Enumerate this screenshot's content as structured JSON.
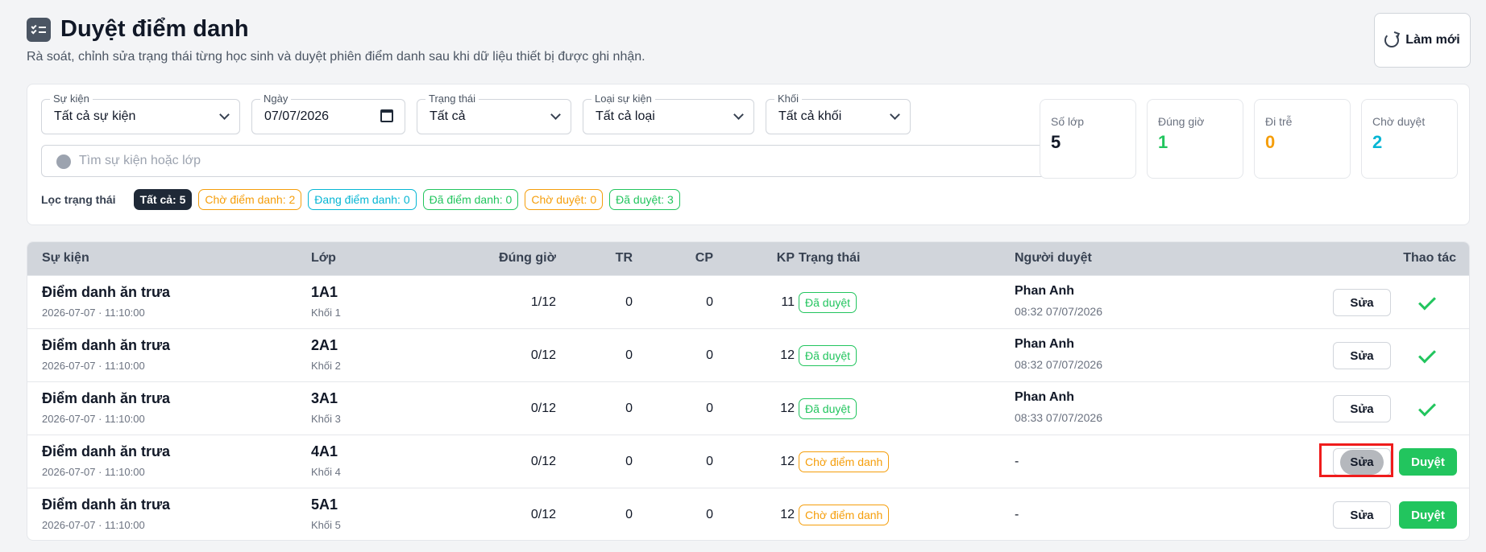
{
  "header": {
    "title": "Duyệt điểm danh",
    "subtitle": "Rà soát, chỉnh sửa trạng thái từng học sinh và duyệt phiên điểm danh sau khi dữ liệu thiết bị được ghi nhận.",
    "refresh_label": "Làm mới"
  },
  "filters": {
    "event": {
      "label": "Sự kiện",
      "value": "Tất cả sự kiện"
    },
    "date": {
      "label": "Ngày",
      "value": "07/07/2026"
    },
    "status": {
      "label": "Trạng thái",
      "value": "Tất cả"
    },
    "event_type": {
      "label": "Loại sự kiện",
      "value": "Tất cả loại"
    },
    "grade": {
      "label": "Khối",
      "value": "Tất cả khối"
    },
    "search_placeholder": "Tìm sự kiện hoặc lớp"
  },
  "status_filter": {
    "label": "Lọc trạng thái",
    "chips": [
      "Tất cả: 5",
      "Chờ điểm danh: 2",
      "Đang điểm danh: 0",
      "Đã điểm danh: 0",
      "Chờ duyệt: 0",
      "Đã duyệt: 3"
    ]
  },
  "stats": [
    {
      "label": "Số lớp",
      "value": "5",
      "color": "#111827"
    },
    {
      "label": "Đúng giờ",
      "value": "1",
      "color": "#22c55e"
    },
    {
      "label": "Đi trễ",
      "value": "0",
      "color": "#f59e0b"
    },
    {
      "label": "Chờ duyệt",
      "value": "2",
      "color": "#06b6d4"
    }
  ],
  "table": {
    "columns": [
      "Sự kiện",
      "Lớp",
      "Đúng giờ",
      "TR",
      "CP",
      "KP",
      "Trạng thái",
      "Người duyệt",
      "Thao tác"
    ],
    "edit_label": "Sửa",
    "approve_label": "Duyệt",
    "rows": [
      {
        "event": "Điểm danh ăn trưa",
        "time": "2026-07-07 · 11:10:00",
        "class": "1A1",
        "grade": "Khối 1",
        "ontime": "1/12",
        "tr": "0",
        "cp": "0",
        "kp": "11",
        "status": "Đã duyệt",
        "reviewer": "Phan Anh",
        "reviewed_at": "08:32 07/07/2026"
      },
      {
        "event": "Điểm danh ăn trưa",
        "time": "2026-07-07 · 11:10:00",
        "class": "2A1",
        "grade": "Khối 2",
        "ontime": "0/12",
        "tr": "0",
        "cp": "0",
        "kp": "12",
        "status": "Đã duyệt",
        "reviewer": "Phan Anh",
        "reviewed_at": "08:32 07/07/2026"
      },
      {
        "event": "Điểm danh ăn trưa",
        "time": "2026-07-07 · 11:10:00",
        "class": "3A1",
        "grade": "Khối 3",
        "ontime": "0/12",
        "tr": "0",
        "cp": "0",
        "kp": "12",
        "status": "Đã duyệt",
        "reviewer": "Phan Anh",
        "reviewed_at": "08:33 07/07/2026"
      },
      {
        "event": "Điểm danh ăn trưa",
        "time": "2026-07-07 · 11:10:00",
        "class": "4A1",
        "grade": "Khối 4",
        "ontime": "0/12",
        "tr": "0",
        "cp": "0",
        "kp": "12",
        "status": "Chờ điểm danh",
        "reviewer": "-"
      },
      {
        "event": "Điểm danh ăn trưa",
        "time": "2026-07-07 · 11:10:00",
        "class": "5A1",
        "grade": "Khối 5",
        "ontime": "0/12",
        "tr": "0",
        "cp": "0",
        "kp": "12",
        "status": "Chờ điểm danh",
        "reviewer": "-"
      }
    ]
  }
}
